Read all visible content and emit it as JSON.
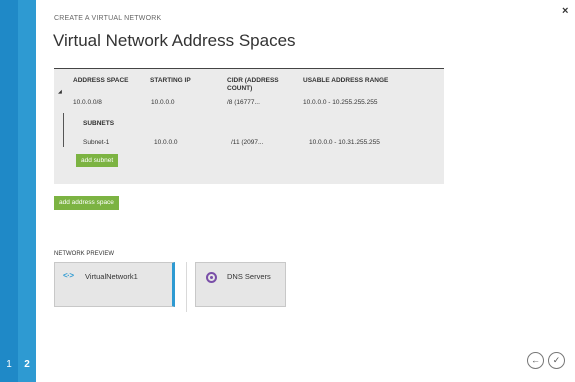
{
  "wizard": {
    "subtitle": "CREATE A VIRTUAL NETWORK",
    "title": "Virtual Network Address Spaces",
    "close": "×",
    "steps": [
      "1",
      "2"
    ]
  },
  "address_table": {
    "headers": {
      "address_space": "ADDRESS SPACE",
      "starting_ip": "STARTING IP",
      "cidr": "CIDR (ADDRESS COUNT)",
      "usable_range": "USABLE ADDRESS RANGE"
    },
    "address_space": {
      "caret": "◢",
      "address": "10.0.0.0/8",
      "starting_ip": "10.0.0.0",
      "cidr": "/8 (16777...",
      "usable_range": "10.0.0.0 - 10.255.255.255"
    },
    "subnets_label": "SUBNETS",
    "subnet": {
      "name": "Subnet-1",
      "starting_ip": "10.0.0.0",
      "cidr": "/11 (2097...",
      "usable_range": "10.0.0.0 - 10.31.255.255"
    },
    "add_subnet": "add subnet"
  },
  "add_address_space": "add address space",
  "network_preview": {
    "label": "NETWORK PREVIEW",
    "cards": [
      {
        "label": "VirtualNetwork1",
        "icon": "virtual-network-icon"
      },
      {
        "label": "DNS Servers",
        "icon": "dns-servers-icon"
      }
    ]
  },
  "nav": {
    "back": "←",
    "done": "✓"
  },
  "colors": {
    "rail": "#2e9ad2",
    "rail_dark": "#1f89c7",
    "green": "#7cb342",
    "dns": "#7a4fa8"
  }
}
